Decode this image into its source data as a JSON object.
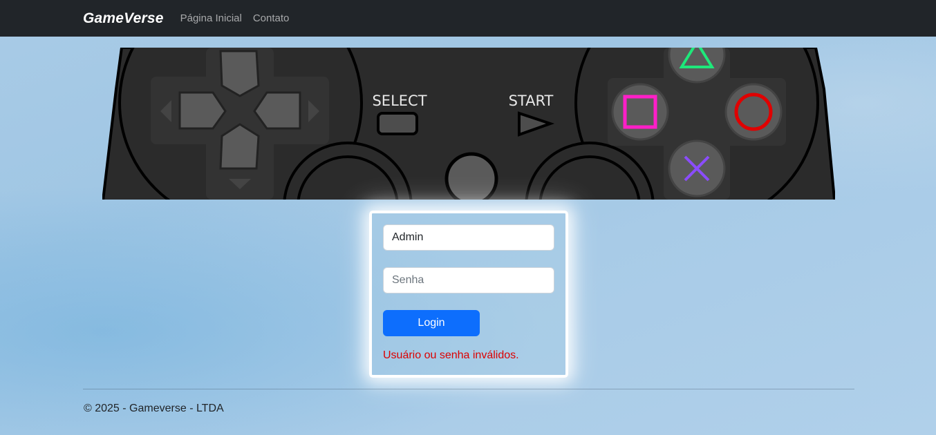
{
  "navbar": {
    "brand": "GameVerse",
    "links": [
      "Página Inicial",
      "Contato"
    ]
  },
  "banner": {
    "select_label": "SELECT",
    "start_label": "START",
    "colors": {
      "body": "#2b2b2b",
      "button": "#5a5a5a",
      "triangle": "#1ee87a",
      "square": "#ff1fc8",
      "circle": "#e00000",
      "cross": "#8b4cff"
    }
  },
  "login": {
    "username_value": "Admin",
    "password_placeholder": "Senha",
    "submit_label": "Login",
    "error_message": "Usuário ou senha inválidos."
  },
  "footer": {
    "text": "© 2025 - Gameverse - LTDA"
  },
  "colors": {
    "navbar_bg": "#212529",
    "primary": "#0d6efd",
    "error": "#dc0000"
  }
}
